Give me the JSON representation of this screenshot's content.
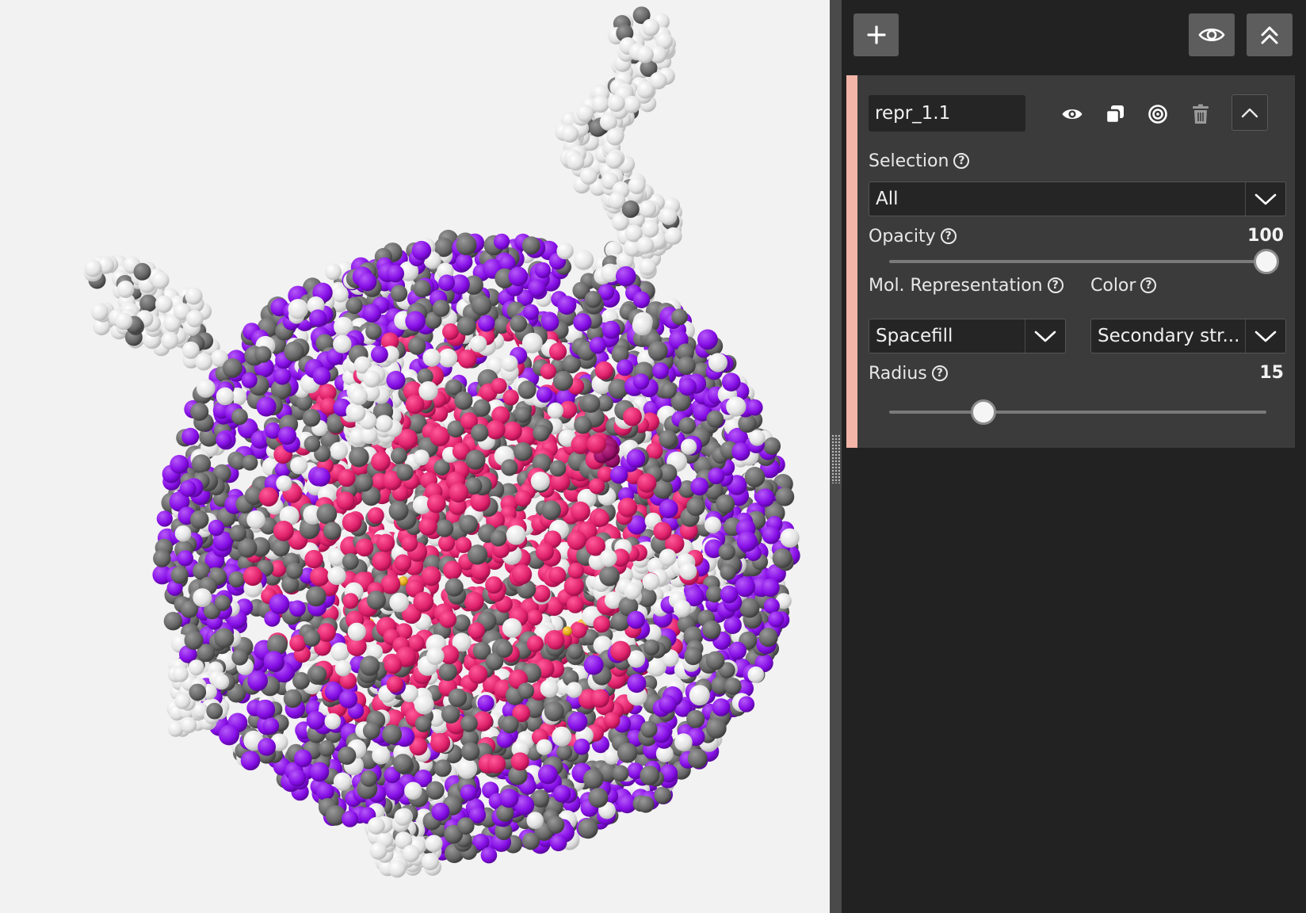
{
  "toolbar": {
    "add_icon": "plus-icon",
    "visibility_icon": "eye-icon",
    "collapse_all_icon": "double-chevron-up-icon"
  },
  "representation": {
    "name": "repr_1.1",
    "actions": [
      "eye-icon",
      "duplicate-icon",
      "focus-target-icon",
      "trash-icon",
      "chevron-up-icon"
    ],
    "accent_color": "#f2b5a8",
    "selection": {
      "label": "Selection",
      "value": "All"
    },
    "opacity": {
      "label": "Opacity",
      "value": "100",
      "fraction": 1.0
    },
    "mol_representation": {
      "label": "Mol. Representation",
      "value": "Spacefill"
    },
    "color": {
      "label": "Color",
      "value": "Secondary str..."
    },
    "radius": {
      "label": "Radius",
      "value": "15",
      "fraction": 0.25
    }
  },
  "viewer": {
    "background": "#f2f2f2",
    "palette": {
      "helix": "#8a0ef0",
      "sheet": "#e8226e",
      "coil": "#f4f4f4",
      "backbone": "#6b6b6b",
      "dark_pink": "#a01070",
      "ligand": "#e8b020"
    }
  }
}
